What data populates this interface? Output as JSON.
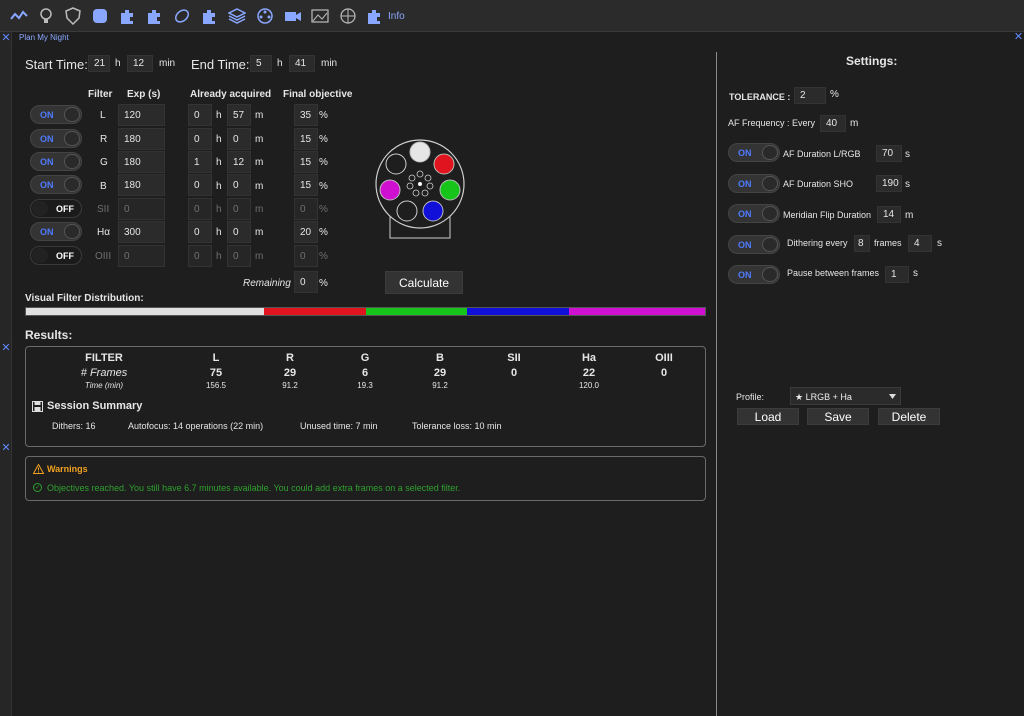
{
  "toolbar": {
    "icons": [
      "graph-icon",
      "bulb-icon",
      "shield-icon",
      "compass-icon",
      "puzzle-icon",
      "puzzle-icon",
      "telescope-icon",
      "puzzle-icon",
      "layers-icon",
      "filter-wheel-icon",
      "camera-icon",
      "image-icon",
      "dome-icon",
      "puzzle-icon"
    ],
    "info_label": "Info"
  },
  "panel": {
    "title": "Plan My Night"
  },
  "time": {
    "start_label": "Start Time:",
    "start_h": "21",
    "start_min": "12",
    "end_label": "End Time:",
    "end_h": "5",
    "end_min": "41",
    "h_unit": "h",
    "min_unit": "min"
  },
  "table": {
    "headers": {
      "filter": "Filter",
      "exp": "Exp (s)",
      "acquired": "Already acquired",
      "objective": "Final objective"
    },
    "rows": [
      {
        "state": "ON",
        "name": "L",
        "exp": "120",
        "acq_h": "0",
        "acq_m": "57",
        "obj": "35"
      },
      {
        "state": "ON",
        "name": "R",
        "exp": "180",
        "acq_h": "0",
        "acq_m": "0",
        "obj": "15"
      },
      {
        "state": "ON",
        "name": "G",
        "exp": "180",
        "acq_h": "1",
        "acq_m": "12",
        "obj": "15"
      },
      {
        "state": "ON",
        "name": "B",
        "exp": "180",
        "acq_h": "0",
        "acq_m": "0",
        "obj": "15"
      },
      {
        "state": "OFF",
        "name": "SII",
        "exp": "0",
        "acq_h": "0",
        "acq_m": "0",
        "obj": "0"
      },
      {
        "state": "ON",
        "name": "Hα",
        "exp": "300",
        "acq_h": "0",
        "acq_m": "0",
        "obj": "20"
      },
      {
        "state": "OFF",
        "name": "OIII",
        "exp": "0",
        "acq_h": "0",
        "acq_m": "0",
        "obj": "0"
      }
    ],
    "h_unit": "h",
    "m_unit": "m",
    "pct_unit": "%",
    "remaining_label": "Remaining",
    "remaining_value": "0"
  },
  "calculate_label": "Calculate",
  "distribution": {
    "label": "Visual Filter Distribution:",
    "segments": [
      {
        "color": "#e0e0e0",
        "fraction": 0.35
      },
      {
        "color": "#e0141e",
        "fraction": 0.15
      },
      {
        "color": "#16c41a",
        "fraction": 0.15
      },
      {
        "color": "#1010d8",
        "fraction": 0.15
      },
      {
        "color": "#d010d0",
        "fraction": 0.2
      }
    ]
  },
  "results": {
    "title": "Results:",
    "filter_label": "FILTER",
    "frames_label": "# Frames",
    "time_label": "Time (min)",
    "columns": [
      {
        "name": "L",
        "frames": "75",
        "time": "156.5"
      },
      {
        "name": "R",
        "frames": "29",
        "time": "91.2"
      },
      {
        "name": "G",
        "frames": "6",
        "time": "19.3"
      },
      {
        "name": "B",
        "frames": "29",
        "time": "91.2"
      },
      {
        "name": "SII",
        "frames": "0",
        "time": ""
      },
      {
        "name": "Ha",
        "frames": "22",
        "time": "120.0"
      },
      {
        "name": "OIII",
        "frames": "0",
        "time": ""
      }
    ],
    "summary_title": "Session Summary",
    "dithers": "Dithers: 16",
    "autofocus": "Autofocus: 14 operations (22 min)",
    "unused": "Unused time: 7 min",
    "tolerance_loss": "Tolerance loss: 10 min"
  },
  "warnings": {
    "title": "Warnings",
    "message": "Objectives reached. You still have 6.7 minutes available. You could add extra frames on a selected filter.",
    "title_color": "#f0a020",
    "message_color": "#2fa02f"
  },
  "settings": {
    "title": "Settings:",
    "tolerance_label": "TOLERANCE :",
    "tolerance_value": "2",
    "tolerance_unit": "%",
    "af_freq_label": "AF Frequency : Every",
    "af_freq_value": "40",
    "af_freq_unit": "m",
    "toggles": [
      {
        "state": "ON",
        "label": "AF Duration L/RGB",
        "value": "70",
        "unit": "s"
      },
      {
        "state": "ON",
        "label": "AF Duration SHO",
        "value": "190",
        "unit": "s"
      },
      {
        "state": "ON",
        "label": "Meridian Flip Duration",
        "value": "14",
        "unit": "m"
      },
      {
        "state": "ON",
        "label": "Dithering every",
        "value": "8",
        "unit": "frames",
        "value2": "4",
        "unit2": "s"
      },
      {
        "state": "ON",
        "label": "Pause between frames",
        "value": "1",
        "unit": "s"
      }
    ],
    "profile_label": "Profile:",
    "profile_value": "★ LRGB + Ha",
    "load_label": "Load",
    "save_label": "Save",
    "delete_label": "Delete"
  },
  "colors": {
    "accent": "#4f7bff",
    "background": "#1e1e1e",
    "panel": "#2b2b2b"
  }
}
